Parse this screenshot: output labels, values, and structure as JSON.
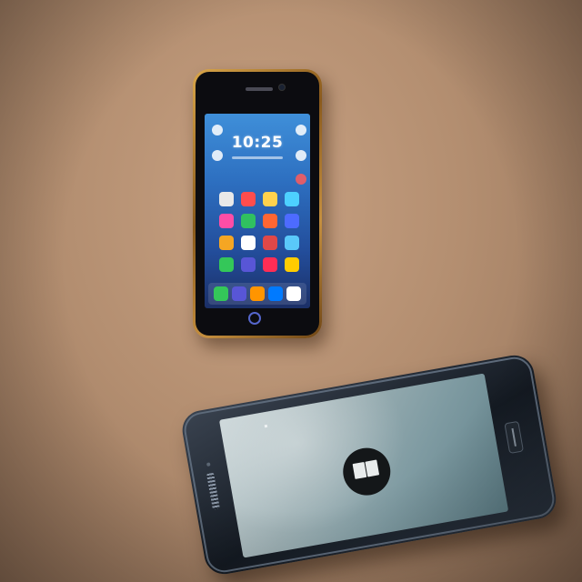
{
  "scene": {
    "description_free": true,
    "background_color": "#b38e70"
  },
  "phone_upright": {
    "bezel_color": "#c58f3e",
    "screen": {
      "clock_text": "10:25",
      "wallpaper_color": "#2d6fc0",
      "app_icon_colors": [
        "#e8e8e8",
        "#ff4d4d",
        "#ffd24d",
        "#4dd0ff",
        "#ff4da6",
        "#30c060",
        "#ff6633",
        "#4d6bff",
        "#f5a623",
        "#ffffff",
        "#e04848",
        "#5ac8fa",
        "#34c759",
        "#5856d6",
        "#ff2d55",
        "#ffcc00"
      ],
      "dock_icon_colors": [
        "#34c759",
        "#5856d6",
        "#ff9500",
        "#007aff",
        "#ffffff"
      ]
    },
    "home_button_icon": "circle-home-button"
  },
  "phone_tilted": {
    "screen_color": "#9eb1b5",
    "app_logo_icon": "two-square-logo-icon",
    "home_button_icon": "oval-home-button"
  }
}
